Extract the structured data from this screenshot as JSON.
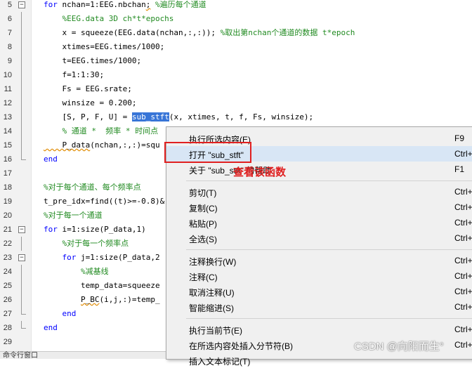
{
  "editor": {
    "lines": [
      {
        "num": "5",
        "parts": [
          {
            "t": "for",
            "c": "kw"
          },
          {
            "t": " nchan=1:EEG.nbchan"
          },
          {
            "t": ";",
            "c": "wv"
          },
          {
            "t": " %遍历每个通道",
            "c": "cm"
          }
        ]
      },
      {
        "num": "6",
        "parts": [
          {
            "t": "    %EEG.data 3D ch*t*epochs",
            "c": "cm"
          }
        ]
      },
      {
        "num": "7",
        "parts": [
          {
            "t": "    x = squeeze(EEG.data(nchan,:,:)); "
          },
          {
            "t": "%取出第nchan个通道的数据 t*epoch",
            "c": "cm"
          }
        ]
      },
      {
        "num": "8",
        "parts": [
          {
            "t": "    xtimes=EEG.times/1000;"
          }
        ]
      },
      {
        "num": "9",
        "parts": [
          {
            "t": "    t=EEG.times/1000;"
          }
        ]
      },
      {
        "num": "10",
        "parts": [
          {
            "t": "    f=1:1:30;"
          }
        ]
      },
      {
        "num": "11",
        "parts": [
          {
            "t": "    Fs = EEG.srate;"
          }
        ]
      },
      {
        "num": "12",
        "parts": [
          {
            "t": "    winsize = 0.200;"
          }
        ]
      },
      {
        "num": "13",
        "parts": [
          {
            "t": "    [S, P, F, U] = "
          },
          {
            "t": "sub_stft",
            "c": "sel"
          },
          {
            "t": "(x, xtimes, t, f, Fs, winsize);"
          }
        ]
      },
      {
        "num": "14",
        "parts": [
          {
            "t": "    % 通道 *  频率 * 时间点",
            "c": "cm"
          }
        ]
      },
      {
        "num": "15",
        "parts": [
          {
            "t": "    P_data",
            "c": "wv"
          },
          {
            "t": "(nchan,:,:)=squ"
          }
        ]
      },
      {
        "num": "16",
        "parts": [
          {
            "t": "end",
            "c": "kw"
          }
        ]
      },
      {
        "num": "17",
        "parts": []
      },
      {
        "num": "18",
        "parts": [
          {
            "t": "%对于每个通道、每个频率点",
            "c": "cm"
          }
        ]
      },
      {
        "num": "19",
        "parts": [
          {
            "t": "t_pre_idx=find((t)>=-0.8)&"
          }
        ]
      },
      {
        "num": "20",
        "parts": [
          {
            "t": "%对于每一个通道",
            "c": "cm"
          }
        ]
      },
      {
        "num": "21",
        "parts": [
          {
            "t": "for",
            "c": "kw"
          },
          {
            "t": " i=1:size(P_data,1)"
          }
        ]
      },
      {
        "num": "22",
        "parts": [
          {
            "t": "    %对于每一个频率点",
            "c": "cm"
          }
        ]
      },
      {
        "num": "23",
        "parts": [
          {
            "t": "    "
          },
          {
            "t": "for",
            "c": "kw"
          },
          {
            "t": " j=1:size(P_data,2"
          }
        ]
      },
      {
        "num": "24",
        "parts": [
          {
            "t": "        %减基线",
            "c": "cm"
          }
        ]
      },
      {
        "num": "25",
        "parts": [
          {
            "t": "        temp_data=squeeze"
          }
        ]
      },
      {
        "num": "26",
        "parts": [
          {
            "t": "        "
          },
          {
            "t": "P_BC",
            "c": "wv"
          },
          {
            "t": "(i,j,:)=temp_"
          }
        ]
      },
      {
        "num": "27",
        "parts": [
          {
            "t": "    "
          },
          {
            "t": "end",
            "c": "kw"
          }
        ]
      },
      {
        "num": "28",
        "parts": [
          {
            "t": "end",
            "c": "kw"
          }
        ]
      },
      {
        "num": "29",
        "parts": []
      }
    ]
  },
  "context_menu": {
    "items": [
      {
        "label": "执行所选内容(E)",
        "shortcut": "F9"
      },
      {
        "label": "打开 \"sub_stft\"",
        "shortcut": "Ctrl+"
      },
      {
        "label": "关于 \"sub_stft\" 的帮助",
        "shortcut": "F1"
      },
      {
        "label": "剪切(T)",
        "shortcut": "Ctrl+"
      },
      {
        "label": "复制(C)",
        "shortcut": "Ctrl+"
      },
      {
        "label": "粘贴(P)",
        "shortcut": "Ctrl+"
      },
      {
        "label": "全选(S)",
        "shortcut": "Ctrl+"
      },
      {
        "label": "注释换行(W)",
        "shortcut": "Ctrl+"
      },
      {
        "label": "注释(C)",
        "shortcut": "Ctrl+"
      },
      {
        "label": "取消注释(U)",
        "shortcut": "Ctrl+"
      },
      {
        "label": "智能缩进(S)",
        "shortcut": "Ctrl+"
      },
      {
        "label": "执行当前节(E)",
        "shortcut": "Ctrl+"
      },
      {
        "label": "在所选内容处插入分节符(B)",
        "shortcut": "Ctrl+"
      },
      {
        "label": "插入文本标记(T)",
        "shortcut": ""
      }
    ],
    "highlighted_index": 1
  },
  "annotation": {
    "text": "查看该函数"
  },
  "command_window": {
    "title": "命令行窗口"
  },
  "watermark": {
    "text": "CSDN @向阳而生°"
  },
  "colors": {
    "keyword": "#0000ff",
    "comment": "#228b22",
    "selection": "#3875d7",
    "annotation": "#e02020"
  }
}
